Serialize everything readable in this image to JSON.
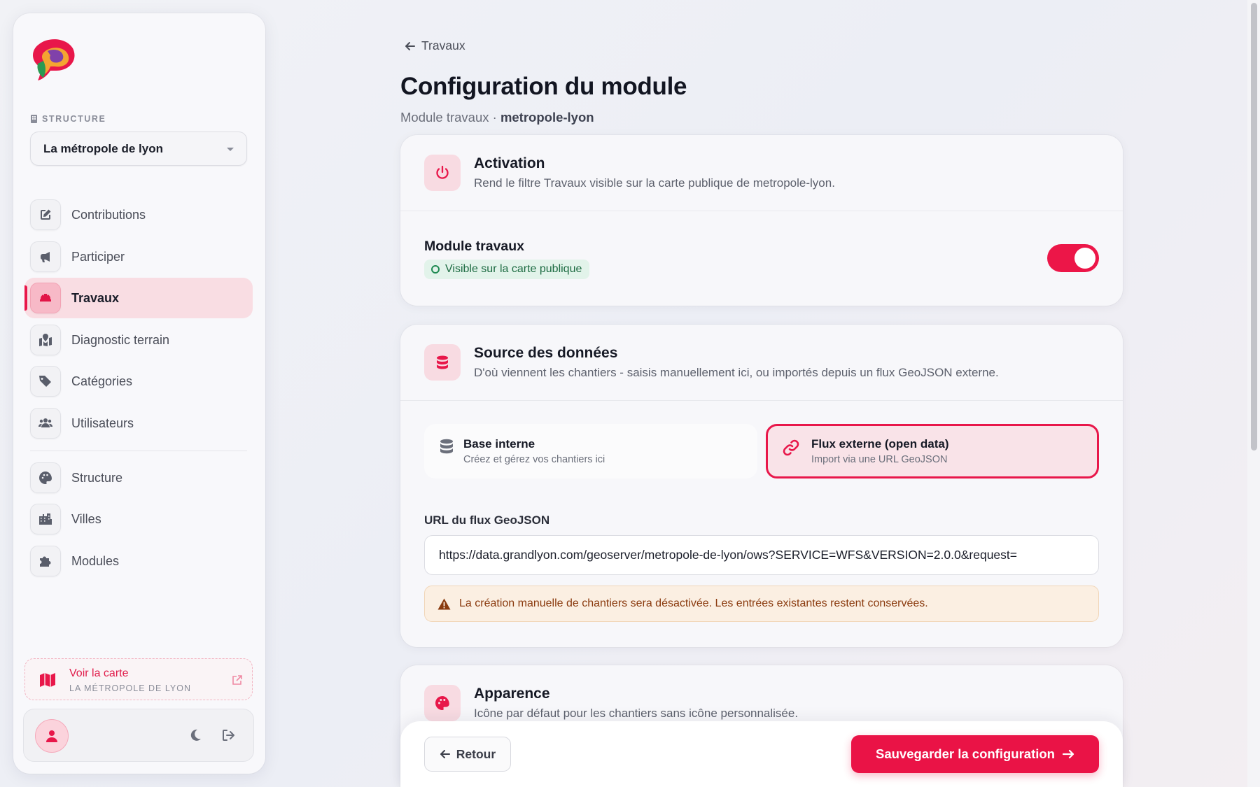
{
  "sidebar": {
    "structure_label": "STRUCTURE",
    "structure_value": "La métropole de lyon",
    "nav_main": [
      {
        "label": "Contributions",
        "icon": "edit-icon"
      },
      {
        "label": "Participer",
        "icon": "megaphone-icon"
      },
      {
        "label": "Travaux",
        "icon": "hard-hat-icon",
        "active": true
      },
      {
        "label": "Diagnostic terrain",
        "icon": "map-location-icon"
      },
      {
        "label": "Catégories",
        "icon": "tags-icon"
      },
      {
        "label": "Utilisateurs",
        "icon": "users-icon"
      }
    ],
    "nav_admin": [
      {
        "label": "Structure",
        "icon": "palette-icon"
      },
      {
        "label": "Villes",
        "icon": "city-icon"
      },
      {
        "label": "Modules",
        "icon": "puzzle-icon"
      }
    ],
    "map_link": {
      "title": "Voir la carte",
      "subtitle": "LA MÉTROPOLE DE LYON"
    }
  },
  "header": {
    "back_label": "Travaux",
    "title": "Configuration du module",
    "subtitle_prefix": "Module travaux · ",
    "subtitle_slug": "metropole-lyon"
  },
  "activation": {
    "title": "Activation",
    "description": "Rend le filtre Travaux visible sur la carte publique de metropole-lyon.",
    "module_label": "Module travaux",
    "status_badge": "Visible sur la carte publique",
    "enabled": true
  },
  "source": {
    "title": "Source des données",
    "description": "D'où viennent les chantiers - saisis manuellement ici, ou importés depuis un flux GeoJSON externe.",
    "options": [
      {
        "title": "Base interne",
        "subtitle": "Créez et gérez vos chantiers ici",
        "selected": false
      },
      {
        "title": "Flux externe (open data)",
        "subtitle": "Import via une URL GeoJSON",
        "selected": true
      }
    ],
    "url_label": "URL du flux GeoJSON",
    "url_value": "https://data.grandlyon.com/geoserver/metropole-de-lyon/ows?SERVICE=WFS&VERSION=2.0.0&request=",
    "warning": "La création manuelle de chantiers sera désactivée. Les entrées existantes restent conservées."
  },
  "appearance": {
    "title": "Apparence",
    "description": "Icône par défaut pour les chantiers sans icône personnalisée."
  },
  "footer": {
    "back_label": "Retour",
    "save_label": "Sauvegarder la configuration"
  },
  "colors": {
    "accent": "#e8174a",
    "success": "#1f8a52",
    "warning_text": "#8a3a0e"
  }
}
